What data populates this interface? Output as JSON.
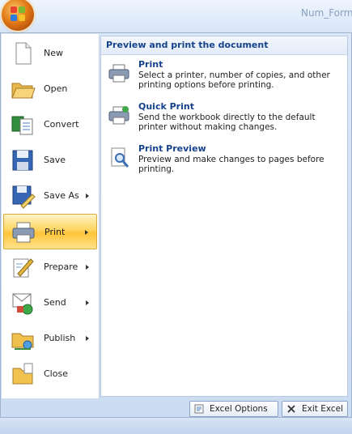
{
  "window": {
    "title": "Num_Forma"
  },
  "left_menu": {
    "items": [
      {
        "label": "New",
        "has_submenu": false
      },
      {
        "label": "Open",
        "has_submenu": false
      },
      {
        "label": "Convert",
        "has_submenu": false
      },
      {
        "label": "Save",
        "has_submenu": false
      },
      {
        "label": "Save As",
        "has_submenu": true
      },
      {
        "label": "Print",
        "has_submenu": true,
        "active": true
      },
      {
        "label": "Prepare",
        "has_submenu": true
      },
      {
        "label": "Send",
        "has_submenu": true
      },
      {
        "label": "Publish",
        "has_submenu": true
      },
      {
        "label": "Close",
        "has_submenu": false
      }
    ]
  },
  "right_panel": {
    "header": "Preview and print the document",
    "options": [
      {
        "title": "Print",
        "description": "Select a printer, number of copies, and other printing options before printing."
      },
      {
        "title": "Quick Print",
        "description": "Send the workbook directly to the default printer without making changes."
      },
      {
        "title": "Print Preview",
        "description": "Preview and make changes to pages before printing."
      }
    ]
  },
  "footer_buttons": {
    "excel_options": "Excel Options",
    "exit_excel": "Exit Excel"
  },
  "colors": {
    "accent": "#15428b",
    "active_item": "#ffc43a",
    "orb": "#e37a15"
  }
}
